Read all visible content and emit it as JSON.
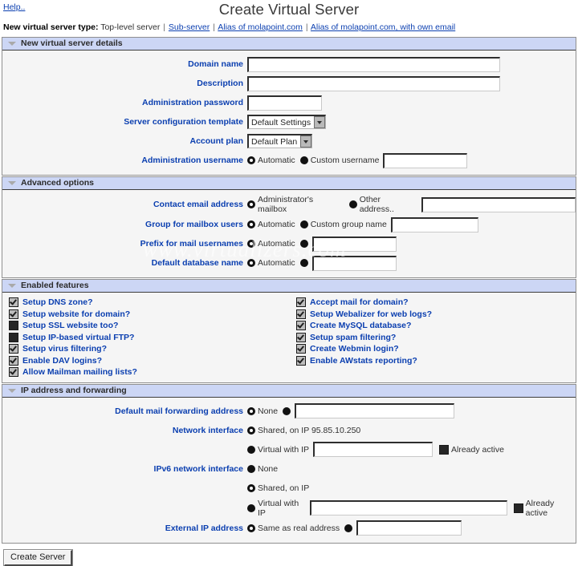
{
  "header": {
    "help_label": "Help..",
    "title": "Create Virtual Server"
  },
  "server_type": {
    "label": "New virtual server type:",
    "options": [
      {
        "label": "Top-level server",
        "selected": true
      },
      {
        "label": "Sub-server",
        "selected": false
      },
      {
        "label": "Alias of molapoint.com",
        "selected": false
      },
      {
        "label": "Alias of molapoint.com, with own email",
        "selected": false
      }
    ],
    "separator": "|"
  },
  "watermark": "www.virtualizers.com",
  "sections": {
    "details": {
      "title": "New virtual server details",
      "fields": {
        "domain_name": {
          "label": "Domain name",
          "value": ""
        },
        "description": {
          "label": "Description",
          "value": ""
        },
        "admin_password": {
          "label": "Administration password",
          "value": ""
        },
        "config_template": {
          "label": "Server configuration template",
          "value": "Default Settings"
        },
        "account_plan": {
          "label": "Account plan",
          "value": "Default Plan"
        },
        "admin_username": {
          "label": "Administration username",
          "automatic_label": "Automatic",
          "custom_label": "Custom username",
          "custom_value": ""
        }
      }
    },
    "advanced": {
      "title": "Advanced options",
      "fields": {
        "contact_email": {
          "label": "Contact email address",
          "default_label": "Administrator's mailbox",
          "other_label": "Other address..",
          "other_value": ""
        },
        "mailbox_group": {
          "label": "Group for mailbox users",
          "automatic_label": "Automatic",
          "custom_label": "Custom group name",
          "custom_value": ""
        },
        "mail_prefix": {
          "label": "Prefix for mail usernames",
          "automatic_label": "Automatic",
          "custom_value": ""
        },
        "database_name": {
          "label": "Default database name",
          "automatic_label": "Automatic",
          "custom_value": ""
        }
      }
    },
    "features": {
      "title": "Enabled features",
      "left": [
        {
          "label": "Setup DNS zone?",
          "checked": true
        },
        {
          "label": "Setup website for domain?",
          "checked": true
        },
        {
          "label": "Setup SSL website too?",
          "checked": false
        },
        {
          "label": "Setup IP-based virtual FTP?",
          "checked": false
        },
        {
          "label": "Setup virus filtering?",
          "checked": true
        },
        {
          "label": "Enable DAV logins?",
          "checked": true
        },
        {
          "label": "Allow Mailman mailing lists?",
          "checked": true
        }
      ],
      "right": [
        {
          "label": "Accept mail for domain?",
          "checked": true
        },
        {
          "label": "Setup Webalizer for web logs?",
          "checked": true
        },
        {
          "label": "Create MySQL database?",
          "checked": true
        },
        {
          "label": "Setup spam filtering?",
          "checked": true
        },
        {
          "label": "Create Webmin login?",
          "checked": true
        },
        {
          "label": "Enable AWstats reporting?",
          "checked": true
        }
      ]
    },
    "ip": {
      "title": "IP address and forwarding",
      "fields": {
        "mail_forwarding": {
          "label": "Default mail forwarding address",
          "none_label": "None",
          "other_value": ""
        },
        "network_interface": {
          "label": "Network interface",
          "shared_label": "Shared, on IP 95.85.10.250",
          "virtual_label": "Virtual with IP",
          "virtual_value": "",
          "already_active_label": "Already active"
        },
        "ipv6_interface": {
          "label": "IPv6 network interface",
          "none_label": "None",
          "shared_label": "Shared, on IP",
          "virtual_label": "Virtual with IP",
          "virtual_value": "",
          "already_active_label": "Already active"
        },
        "external_ip": {
          "label": "External IP address",
          "same_label": "Same as real address",
          "custom_value": ""
        }
      }
    }
  },
  "footer": {
    "create_label": "Create Server"
  }
}
